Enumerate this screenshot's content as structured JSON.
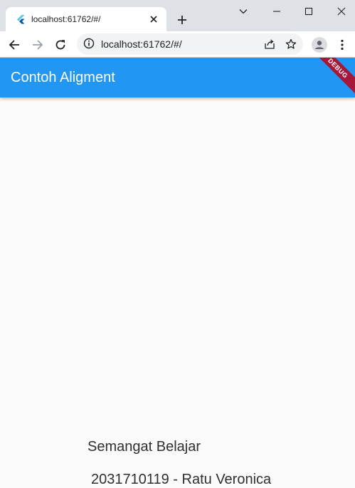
{
  "browser": {
    "tab": {
      "title": "localhost:61762/#/",
      "favicon": "flutter-logo-icon",
      "close_icon": "close-icon"
    },
    "new_tab_icon": "plus-icon",
    "window_controls": [
      "chevron-down-icon",
      "minimize-icon",
      "maximize-icon",
      "close-icon"
    ],
    "toolbar": {
      "back_icon": "arrow-left-icon",
      "forward_icon": "arrow-right-icon",
      "reload_icon": "reload-icon",
      "site_info_icon": "info-icon",
      "url": "localhost:61762/#/",
      "share_icon": "share-icon",
      "bookmark_icon": "star-icon",
      "profile_icon": "avatar-icon",
      "menu_icon": "kebab-menu-icon"
    }
  },
  "app": {
    "appbar": {
      "title": "Contoh Aligment",
      "background": "#2196f3"
    },
    "debug_banner": "DEBUG",
    "body": {
      "text_1": "Semangat Belajar",
      "text_2": "2031710119 - Ratu Veronica"
    }
  }
}
